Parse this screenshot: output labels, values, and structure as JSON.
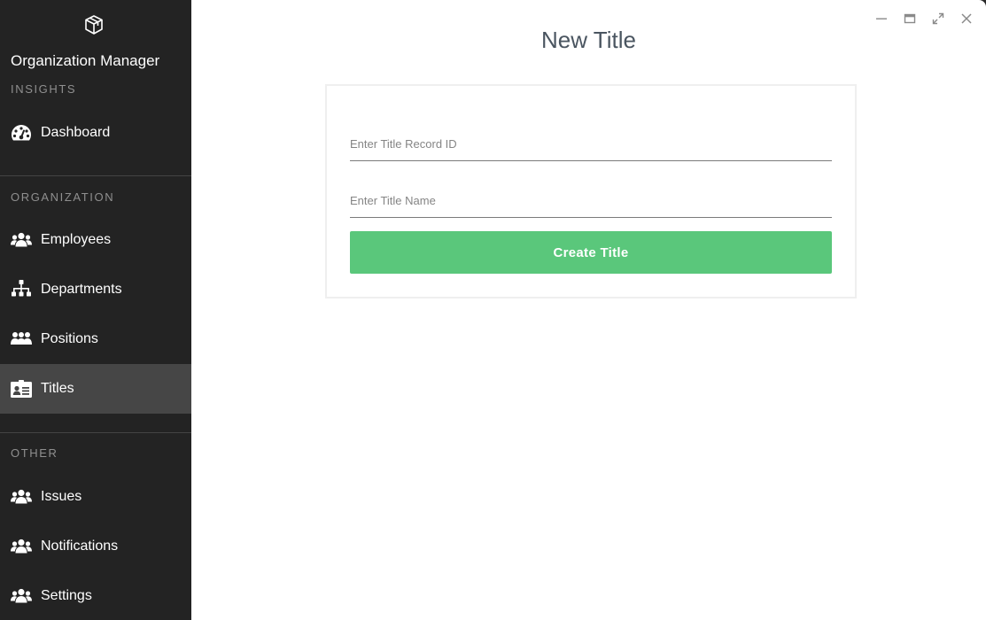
{
  "app": {
    "title": "Organization Manager",
    "logo_icon": "box-logo-icon"
  },
  "sidebar": {
    "sections": [
      {
        "label": "INSIGHTS",
        "items": [
          {
            "label": "Dashboard",
            "icon": "tachometer-icon"
          }
        ]
      },
      {
        "label": "ORGANIZATION",
        "items": [
          {
            "label": "Employees",
            "icon": "users-icon"
          },
          {
            "label": "Departments",
            "icon": "sitemap-icon"
          },
          {
            "label": "Positions",
            "icon": "user-group-icon"
          },
          {
            "label": "Titles",
            "icon": "id-card-icon",
            "active": true
          }
        ]
      },
      {
        "label": "OTHER",
        "items": [
          {
            "label": "Issues",
            "icon": "users-icon"
          },
          {
            "label": "Notifications",
            "icon": "users-icon"
          },
          {
            "label": "Settings",
            "icon": "users-icon"
          }
        ]
      }
    ]
  },
  "window_controls": [
    "minimize-icon",
    "restore-icon",
    "fullscreen-icon",
    "close-icon"
  ],
  "main": {
    "title": "New Title",
    "form": {
      "record_id_placeholder": "Enter Title Record ID",
      "record_id_value": "",
      "name_placeholder": "Enter Title Name",
      "name_value": "",
      "submit_label": "Create Title"
    }
  },
  "colors": {
    "sidebar_bg": "#232323",
    "active_item_bg": "#464646",
    "accent_green": "#5ac77b",
    "title_color": "#4a5560"
  }
}
